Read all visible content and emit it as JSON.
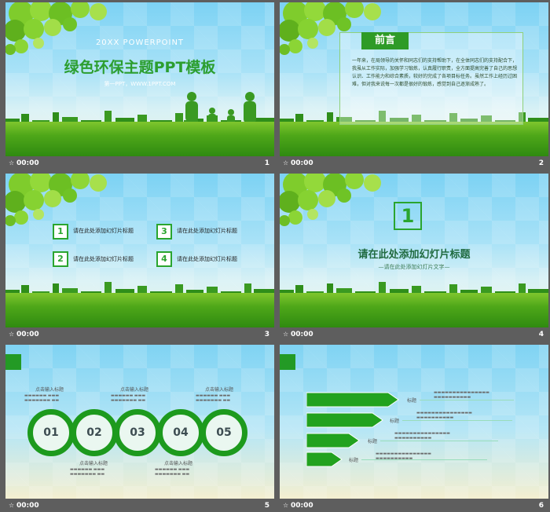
{
  "slides": [
    {
      "number": "1",
      "time": "00:00",
      "subtitle_en": "20XX POWERPOINT",
      "title": "绿色环保主题PPT模板",
      "caption": "第一PPT，WWW.1PPT.COM"
    },
    {
      "number": "2",
      "time": "00:00",
      "heading": "前言",
      "body": "一年来，在局领导的关怀和同志们的支持帮助下，在全体同志们的支持配合下，我虽从工作实际，加强学习锻炼，认真履行职责，全方面提高完善了自己的思想认识、工作能力和综合素质，较好的完成了各项目标任务。虽然工作上经历过困难，但对我来说每一次都是很好的锻炼，感觉到自己逐渐成熟了。"
    },
    {
      "number": "3",
      "time": "00:00",
      "items": [
        {
          "n": "1",
          "label": "请在此处添加幻灯片标题"
        },
        {
          "n": "3",
          "label": "请在此处添加幻灯片标题"
        },
        {
          "n": "2",
          "label": "请在此处添加幻灯片标题"
        },
        {
          "n": "4",
          "label": "请在此处添加幻灯片标题"
        }
      ]
    },
    {
      "number": "4",
      "time": "00:00",
      "big_number": "1",
      "title": "请在此处添加幻灯片标题",
      "subtitle": "—请在此处添加幻灯片文字—"
    },
    {
      "number": "5",
      "time": "00:00",
      "circles": [
        "01",
        "02",
        "03",
        "04",
        "05"
      ],
      "top_label": "点击输入标题",
      "bottom_label": "点击输入标题"
    },
    {
      "number": "6",
      "time": "00:00",
      "arrows": [
        {
          "label": "标题"
        },
        {
          "label": "标题"
        },
        {
          "label": "标题"
        },
        {
          "label": "标题"
        }
      ]
    }
  ]
}
